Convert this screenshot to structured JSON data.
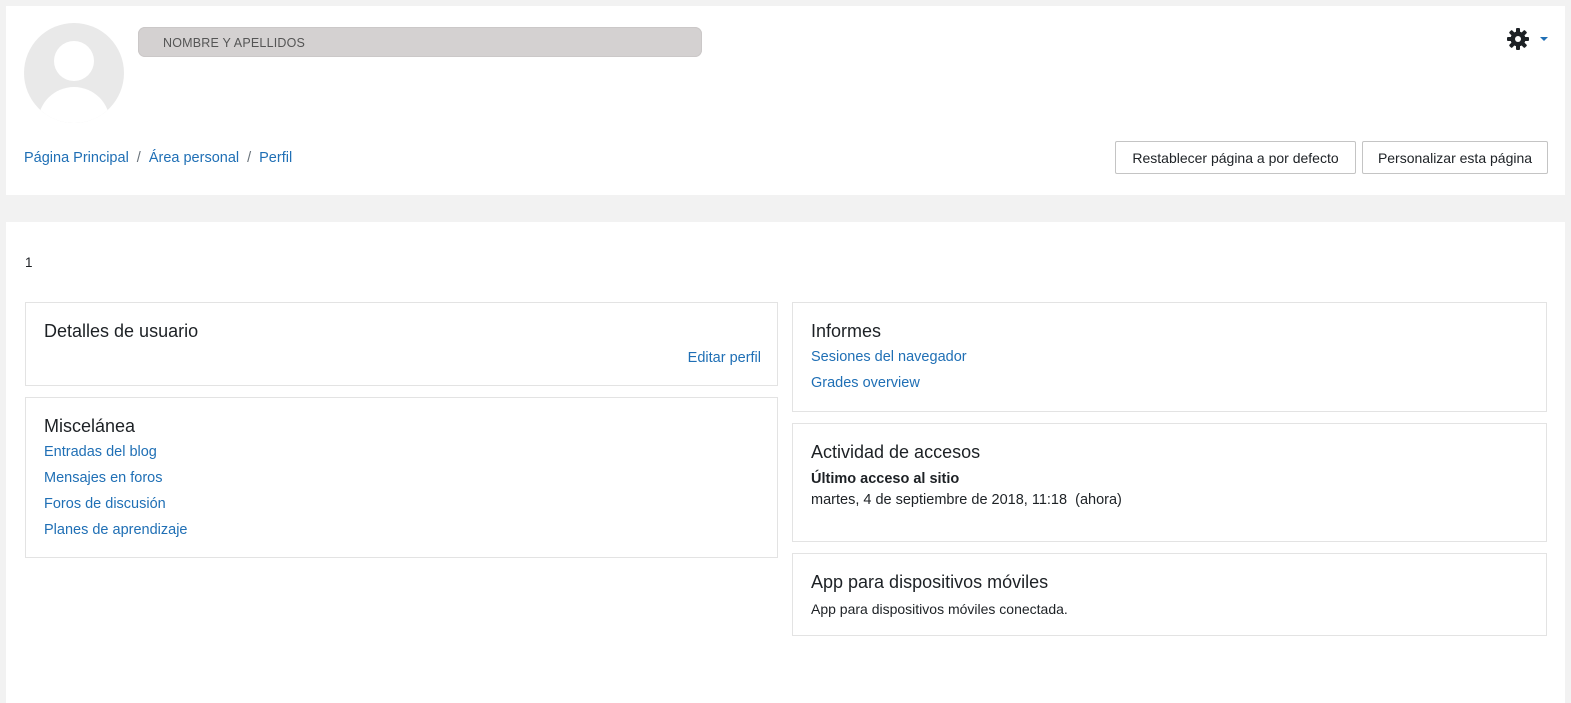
{
  "header": {
    "user_name": "NOMBRE Y APELLIDOS",
    "breadcrumb": {
      "home": "Página Principal",
      "dashboard": "Área personal",
      "profile": "Perfil",
      "separator": "/"
    },
    "reset_button": "Restablecer página a por defecto",
    "customize_button": "Personalizar esta página",
    "settings_icon": "gear-icon",
    "accent_color": "#1f6fb5"
  },
  "main": {
    "counter": "1",
    "user_details": {
      "title": "Detalles de usuario",
      "edit_link": "Editar perfil"
    },
    "misc": {
      "title": "Miscelánea",
      "items": [
        "Entradas del blog",
        "Mensajes en foros",
        "Foros de discusión",
        "Planes de aprendizaje"
      ]
    },
    "reports": {
      "title": "Informes",
      "items": [
        "Sesiones del navegador",
        "Grades overview"
      ]
    },
    "access": {
      "title": "Actividad de accesos",
      "last_access_label": "Último acceso al sitio",
      "last_access_value": "martes, 4 de septiembre de 2018, 11:18  (ahora)"
    },
    "mobile": {
      "title": "App para dispositivos móviles",
      "text": "App para dispositivos móviles conectada."
    }
  }
}
